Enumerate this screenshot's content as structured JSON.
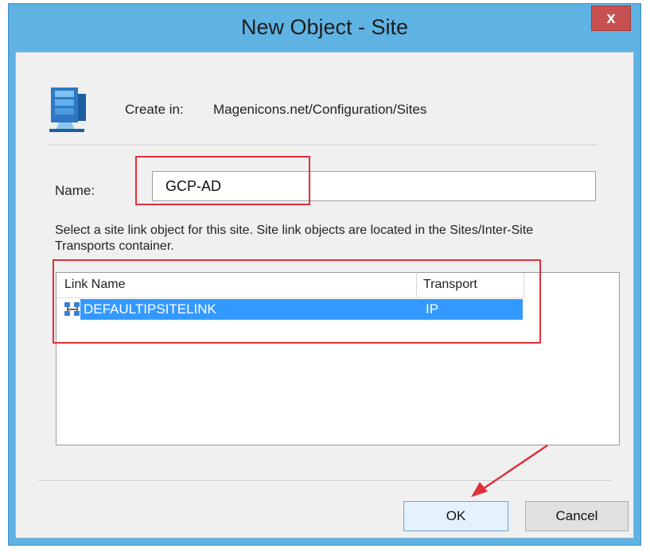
{
  "window": {
    "title": "New Object - Site",
    "close_label": "x"
  },
  "create_in": {
    "label": "Create in:",
    "path": "Magenicons.net/Configuration/Sites"
  },
  "name_field": {
    "label": "Name:",
    "value": "GCP-AD"
  },
  "instruction": "Select a site link object for this site. Site link objects are located in the Sites/Inter-Site Transports container.",
  "site_links": {
    "columns": [
      "Link Name",
      "Transport"
    ],
    "rows": [
      {
        "link_name": "DEFAULTIPSITELINK",
        "transport": "IP",
        "selected": true
      }
    ]
  },
  "buttons": {
    "ok": "OK",
    "cancel": "Cancel"
  },
  "colors": {
    "title_bar": "#5fb3e3",
    "selection": "#3399ff",
    "close_button": "#c75050",
    "annotation": "#e0303a"
  },
  "icons": {
    "dialog_icon": "site-object-icon",
    "row_icon": "site-link-icon"
  }
}
